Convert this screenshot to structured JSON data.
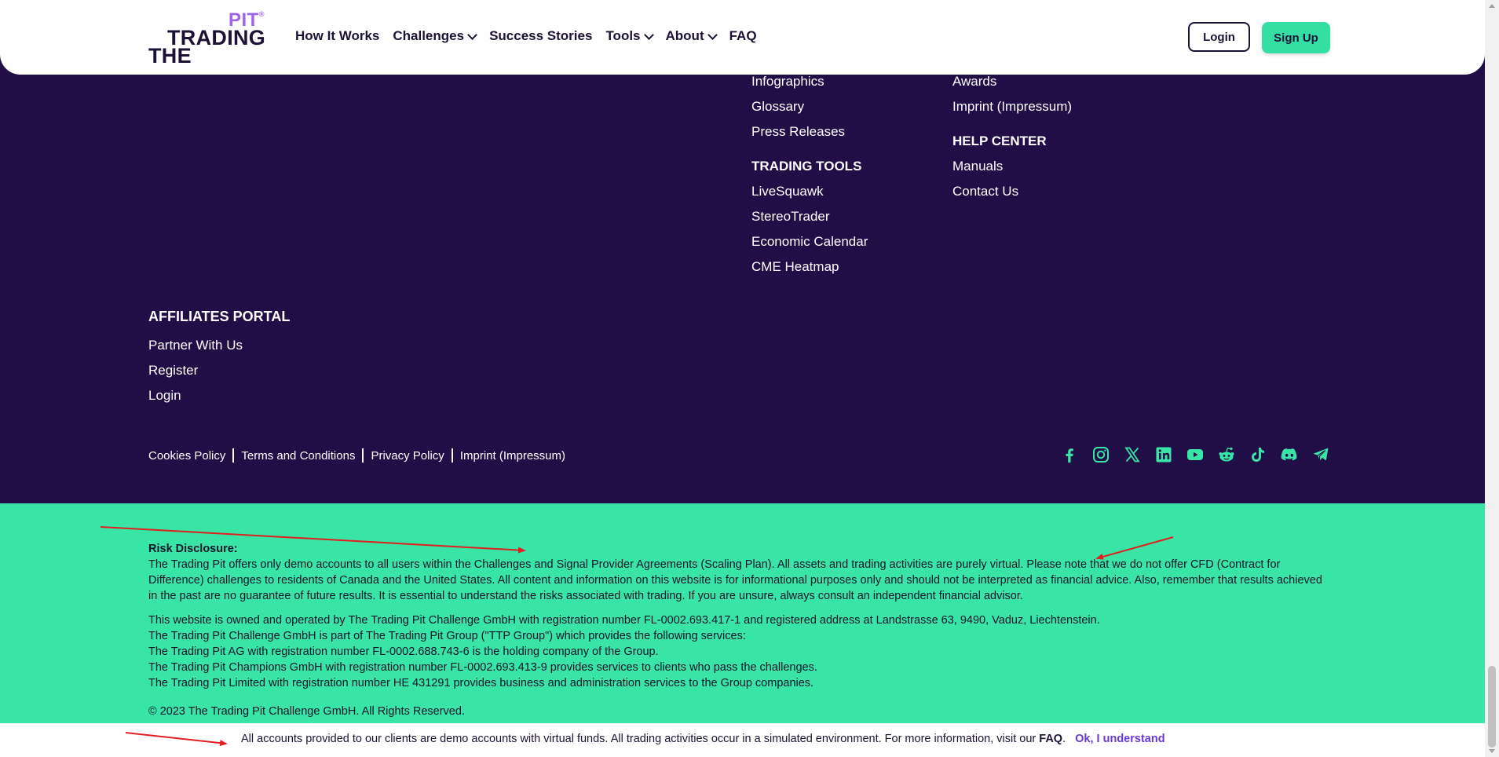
{
  "header": {
    "logo": {
      "pit": "PIT",
      "reg": "®",
      "trading": "TRADING",
      "the": "THE"
    },
    "nav": [
      {
        "label": "How It Works",
        "dropdown": false
      },
      {
        "label": "Challenges",
        "dropdown": true
      },
      {
        "label": "Success Stories",
        "dropdown": false
      },
      {
        "label": "Tools",
        "dropdown": true
      },
      {
        "label": "About",
        "dropdown": true
      },
      {
        "label": "FAQ",
        "dropdown": false
      }
    ],
    "login_label": "Login",
    "signup_label": "Sign Up"
  },
  "footer": {
    "col_a": {
      "top_links": [
        "Infographics",
        "Glossary",
        "Press Releases"
      ],
      "tools_heading": "TRADING TOOLS",
      "tools_links": [
        "LiveSquawk",
        "StereoTrader",
        "Economic Calendar",
        "CME Heatmap"
      ]
    },
    "col_b": {
      "top_links": [
        "Awards",
        "Imprint (Impressum)"
      ],
      "help_heading": "HELP CENTER",
      "help_links": [
        "Manuals",
        "Contact Us"
      ]
    },
    "affiliates": {
      "title": "AFFILIATES PORTAL",
      "links": [
        "Partner With Us",
        "Register",
        "Login"
      ]
    },
    "legal_links": [
      "Cookies Policy",
      "Terms and Conditions",
      "Privacy Policy",
      "Imprint (Impressum)"
    ],
    "socials": [
      "facebook-icon",
      "instagram-icon",
      "x-icon",
      "linkedin-icon",
      "youtube-icon",
      "reddit-icon",
      "tiktok-icon",
      "discord-icon",
      "telegram-icon"
    ]
  },
  "risk": {
    "title": "Risk Disclosure:",
    "para1": "The Trading Pit offers only demo accounts to all users within the Challenges and Signal Provider Agreements (Scaling Plan). All assets and trading activities are purely virtual. Please note that we do not offer CFD (Contract for Difference) challenges to residents of Canada and the United States. All content and information on this website is for informational purposes only and should not be interpreted as financial advice. Also, remember that results achieved in the past are no guarantee of future results. It is essential to understand the risks associated with trading. If you are unsure, always consult an independent financial advisor.",
    "lines": [
      "This website is owned and operated by The Trading Pit Challenge GmbH with registration number FL-0002.693.417-1 and registered address at Landstrasse 63, 9490, Vaduz, Liechtenstein.",
      "The Trading Pit Challenge GmbH is part of The Trading Pit Group (\"TTP Group\") which provides the following services:",
      "The Trading Pit AG with registration number FL-0002.688.743-6 is the holding company of the Group.",
      "The Trading Pit Champions GmbH with registration number FL-0002.693.413-9 provides services to clients who pass the challenges.",
      "The Trading Pit Limited with registration number HE 431291 provides business and administration services to the Group companies."
    ],
    "copyright": "© 2023 The Trading Pit Challenge GmbH. All Rights Reserved."
  },
  "notice": {
    "text": "All accounts provided to our clients are demo accounts with virtual funds. All trading activities occur in a simulated environment. For more information, visit our",
    "faq_label": "FAQ",
    "period": ".",
    "ok_label": "Ok, I understand"
  },
  "colors": {
    "footer_bg": "#210e46",
    "accent_green": "#38e4a6",
    "brand_purple": "#a064f0",
    "dark_text": "#1c1236",
    "link_purple": "#6b3ad6",
    "annotation_red": "#e02020"
  }
}
